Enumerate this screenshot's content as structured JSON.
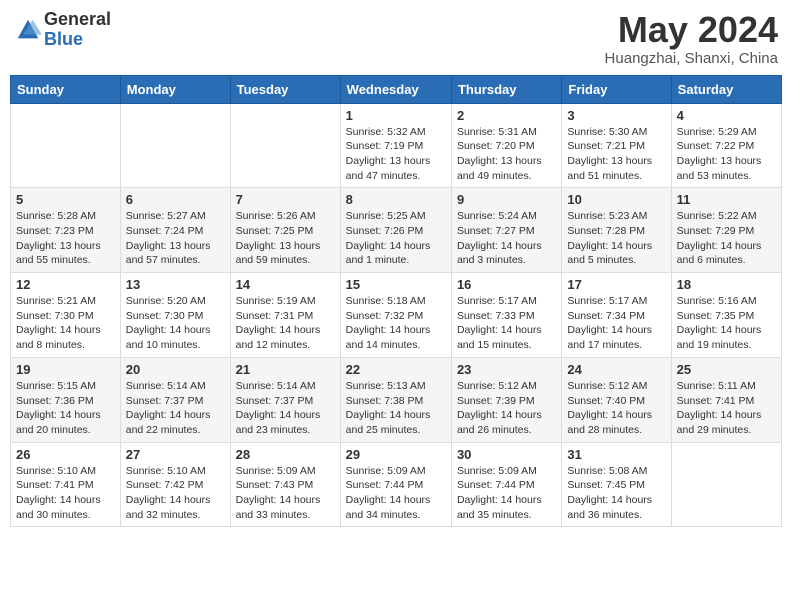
{
  "logo": {
    "general": "General",
    "blue": "Blue"
  },
  "title": {
    "month_year": "May 2024",
    "location": "Huangzhai, Shanxi, China"
  },
  "weekdays": [
    "Sunday",
    "Monday",
    "Tuesday",
    "Wednesday",
    "Thursday",
    "Friday",
    "Saturday"
  ],
  "weeks": [
    [
      {
        "day": "",
        "info": ""
      },
      {
        "day": "",
        "info": ""
      },
      {
        "day": "",
        "info": ""
      },
      {
        "day": "1",
        "info": "Sunrise: 5:32 AM\nSunset: 7:19 PM\nDaylight: 13 hours\nand 47 minutes."
      },
      {
        "day": "2",
        "info": "Sunrise: 5:31 AM\nSunset: 7:20 PM\nDaylight: 13 hours\nand 49 minutes."
      },
      {
        "day": "3",
        "info": "Sunrise: 5:30 AM\nSunset: 7:21 PM\nDaylight: 13 hours\nand 51 minutes."
      },
      {
        "day": "4",
        "info": "Sunrise: 5:29 AM\nSunset: 7:22 PM\nDaylight: 13 hours\nand 53 minutes."
      }
    ],
    [
      {
        "day": "5",
        "info": "Sunrise: 5:28 AM\nSunset: 7:23 PM\nDaylight: 13 hours\nand 55 minutes."
      },
      {
        "day": "6",
        "info": "Sunrise: 5:27 AM\nSunset: 7:24 PM\nDaylight: 13 hours\nand 57 minutes."
      },
      {
        "day": "7",
        "info": "Sunrise: 5:26 AM\nSunset: 7:25 PM\nDaylight: 13 hours\nand 59 minutes."
      },
      {
        "day": "8",
        "info": "Sunrise: 5:25 AM\nSunset: 7:26 PM\nDaylight: 14 hours\nand 1 minute."
      },
      {
        "day": "9",
        "info": "Sunrise: 5:24 AM\nSunset: 7:27 PM\nDaylight: 14 hours\nand 3 minutes."
      },
      {
        "day": "10",
        "info": "Sunrise: 5:23 AM\nSunset: 7:28 PM\nDaylight: 14 hours\nand 5 minutes."
      },
      {
        "day": "11",
        "info": "Sunrise: 5:22 AM\nSunset: 7:29 PM\nDaylight: 14 hours\nand 6 minutes."
      }
    ],
    [
      {
        "day": "12",
        "info": "Sunrise: 5:21 AM\nSunset: 7:30 PM\nDaylight: 14 hours\nand 8 minutes."
      },
      {
        "day": "13",
        "info": "Sunrise: 5:20 AM\nSunset: 7:30 PM\nDaylight: 14 hours\nand 10 minutes."
      },
      {
        "day": "14",
        "info": "Sunrise: 5:19 AM\nSunset: 7:31 PM\nDaylight: 14 hours\nand 12 minutes."
      },
      {
        "day": "15",
        "info": "Sunrise: 5:18 AM\nSunset: 7:32 PM\nDaylight: 14 hours\nand 14 minutes."
      },
      {
        "day": "16",
        "info": "Sunrise: 5:17 AM\nSunset: 7:33 PM\nDaylight: 14 hours\nand 15 minutes."
      },
      {
        "day": "17",
        "info": "Sunrise: 5:17 AM\nSunset: 7:34 PM\nDaylight: 14 hours\nand 17 minutes."
      },
      {
        "day": "18",
        "info": "Sunrise: 5:16 AM\nSunset: 7:35 PM\nDaylight: 14 hours\nand 19 minutes."
      }
    ],
    [
      {
        "day": "19",
        "info": "Sunrise: 5:15 AM\nSunset: 7:36 PM\nDaylight: 14 hours\nand 20 minutes."
      },
      {
        "day": "20",
        "info": "Sunrise: 5:14 AM\nSunset: 7:37 PM\nDaylight: 14 hours\nand 22 minutes."
      },
      {
        "day": "21",
        "info": "Sunrise: 5:14 AM\nSunset: 7:37 PM\nDaylight: 14 hours\nand 23 minutes."
      },
      {
        "day": "22",
        "info": "Sunrise: 5:13 AM\nSunset: 7:38 PM\nDaylight: 14 hours\nand 25 minutes."
      },
      {
        "day": "23",
        "info": "Sunrise: 5:12 AM\nSunset: 7:39 PM\nDaylight: 14 hours\nand 26 minutes."
      },
      {
        "day": "24",
        "info": "Sunrise: 5:12 AM\nSunset: 7:40 PM\nDaylight: 14 hours\nand 28 minutes."
      },
      {
        "day": "25",
        "info": "Sunrise: 5:11 AM\nSunset: 7:41 PM\nDaylight: 14 hours\nand 29 minutes."
      }
    ],
    [
      {
        "day": "26",
        "info": "Sunrise: 5:10 AM\nSunset: 7:41 PM\nDaylight: 14 hours\nand 30 minutes."
      },
      {
        "day": "27",
        "info": "Sunrise: 5:10 AM\nSunset: 7:42 PM\nDaylight: 14 hours\nand 32 minutes."
      },
      {
        "day": "28",
        "info": "Sunrise: 5:09 AM\nSunset: 7:43 PM\nDaylight: 14 hours\nand 33 minutes."
      },
      {
        "day": "29",
        "info": "Sunrise: 5:09 AM\nSunset: 7:44 PM\nDaylight: 14 hours\nand 34 minutes."
      },
      {
        "day": "30",
        "info": "Sunrise: 5:09 AM\nSunset: 7:44 PM\nDaylight: 14 hours\nand 35 minutes."
      },
      {
        "day": "31",
        "info": "Sunrise: 5:08 AM\nSunset: 7:45 PM\nDaylight: 14 hours\nand 36 minutes."
      },
      {
        "day": "",
        "info": ""
      }
    ]
  ]
}
